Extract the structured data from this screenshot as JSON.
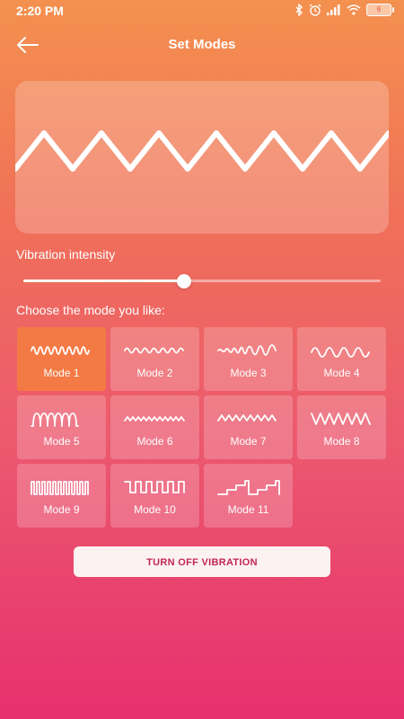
{
  "status_bar": {
    "time": "2:20 PM",
    "icons": [
      "bluetooth-icon",
      "alarm-icon",
      "signal-icon",
      "wifi-icon",
      "battery-icon"
    ],
    "battery_level": "6"
  },
  "header": {
    "title": "Set Modes",
    "back_icon": "arrow-left-icon"
  },
  "intensity": {
    "label": "Vibration intensity",
    "value_fraction": 0.45
  },
  "modes": {
    "prompt": "Choose the mode you like:",
    "selected_index": 0,
    "items": [
      {
        "label": "Mode 1",
        "icon": "wave-tight-icon"
      },
      {
        "label": "Mode 2",
        "icon": "wave-small-icon"
      },
      {
        "label": "Mode 3",
        "icon": "wave-growing-icon"
      },
      {
        "label": "Mode 4",
        "icon": "wave-wide-icon"
      },
      {
        "label": "Mode 5",
        "icon": "pulse-round-icon"
      },
      {
        "label": "Mode 6",
        "icon": "zigzag-small-icon"
      },
      {
        "label": "Mode 7",
        "icon": "zigzag-medium-icon"
      },
      {
        "label": "Mode 8",
        "icon": "zigzag-large-icon"
      },
      {
        "label": "Mode 9",
        "icon": "square-dense-icon"
      },
      {
        "label": "Mode 10",
        "icon": "square-wave-icon"
      },
      {
        "label": "Mode 11",
        "icon": "stairs-icon"
      }
    ]
  },
  "action": {
    "turn_off_label": "TURN OFF VIBRATION"
  },
  "colors": {
    "selected_tile": "#f47a45",
    "button_text": "#c1265a"
  }
}
